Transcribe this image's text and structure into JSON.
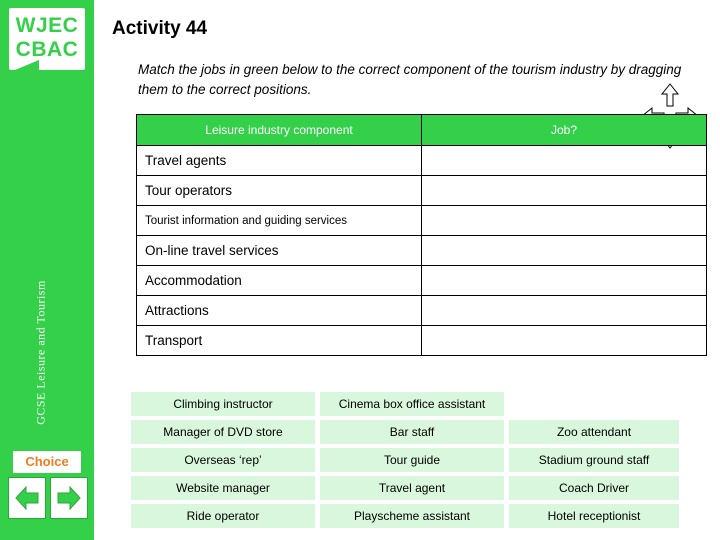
{
  "sidebar": {
    "logo_line1": "WJEC",
    "logo_line2": "CBAC",
    "vertical_label": "GCSE Leisure and Tourism",
    "choice_label": "Choice",
    "prev_icon": "left-arrow-icon",
    "next_icon": "right-arrow-icon"
  },
  "header": {
    "title": "Activity 44",
    "instruction": "Match the jobs in green below to the correct component of the tourism industry by dragging them to the correct positions."
  },
  "table": {
    "headers": [
      "Leisure industry component",
      "Job?"
    ],
    "rows": [
      {
        "component": "Travel agents",
        "job": ""
      },
      {
        "component": "Tour operators",
        "job": ""
      },
      {
        "component": "Tourist information and guiding services",
        "job": ""
      },
      {
        "component": "On-line travel services",
        "job": ""
      },
      {
        "component": "Accommodation",
        "job": ""
      },
      {
        "component": "Attractions",
        "job": ""
      },
      {
        "component": "Transport",
        "job": ""
      }
    ]
  },
  "jobs": {
    "rows": [
      [
        "Climbing instructor",
        "Cinema box office assistant",
        ""
      ],
      [
        "Manager of DVD store",
        "Bar staff",
        "Zoo attendant"
      ],
      [
        "Overseas ‘rep’",
        "Tour guide",
        "Stadium ground staff"
      ],
      [
        "Website manager",
        "Travel agent",
        "Coach Driver"
      ],
      [
        "Ride operator",
        "Playscheme assistant",
        "Hotel receptionist"
      ]
    ]
  },
  "colors": {
    "brand_green": "#35d04a",
    "tile_green": "#d9f7dc",
    "choice_orange": "#f07d20"
  }
}
